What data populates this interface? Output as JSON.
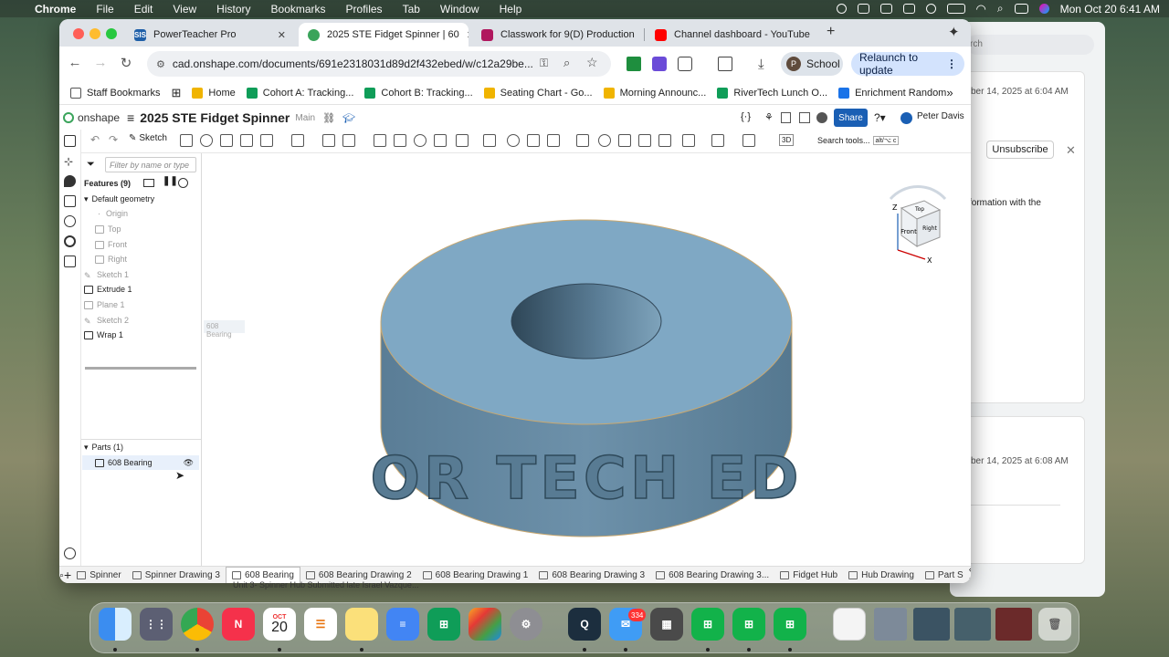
{
  "menubar": {
    "app": "Chrome",
    "items": [
      "File",
      "Edit",
      "View",
      "History",
      "Bookmarks",
      "Profiles",
      "Tab",
      "Window",
      "Help"
    ],
    "clock": "Mon Oct 20  6:41 AM"
  },
  "background_window": {
    "search_placeholder": "rch",
    "text1": "ber 14, 2025 at 6:04 AM",
    "unsubscribe": "Unsubscribe",
    "text2": "formation with the",
    "text3": "ber 14, 2025 at 6:08 AM"
  },
  "tabs": [
    {
      "title": "PowerTeacher Pro",
      "fav_color": "#1f5fa8",
      "fav_text": "SIS"
    },
    {
      "title": "2025 STE Fidget Spinner | 60",
      "fav_color": "#3aa45b",
      "fav_text": ""
    },
    {
      "title": "Classwork for 9(D) Production",
      "fav_color": "#b0185e",
      "fav_text": ""
    },
    {
      "title": "Channel dashboard - YouTube",
      "fav_color": "#ff0000",
      "fav_text": ""
    }
  ],
  "toolbar": {
    "url": "cad.onshape.com/documents/691e2318031d89d2f432ebed/w/c12a29be...",
    "profile_letter": "P",
    "profile_label": "School",
    "relaunch": "Relaunch to update"
  },
  "bookmarks": [
    {
      "label": "Staff Bookmarks",
      "color": "#555"
    },
    {
      "label": "Home",
      "color": "#f0b400"
    },
    {
      "label": "Cohort A: Tracking...",
      "color": "#0f9d58"
    },
    {
      "label": "Cohort B: Tracking...",
      "color": "#0f9d58"
    },
    {
      "label": "Seating Chart - Go...",
      "color": "#f0b400"
    },
    {
      "label": "Morning Announc...",
      "color": "#f0b400"
    },
    {
      "label": "RiverTech Lunch O...",
      "color": "#0f9d58"
    },
    {
      "label": "Enrichment Random",
      "color": "#1a73e8"
    }
  ],
  "onshape": {
    "brand": "onshape",
    "doc_title": "2025 STE Fidget Spinner",
    "branch": "Main",
    "share": "Share",
    "user": "Peter Davis",
    "sketch_label": "Sketch",
    "search_tools": "Search tools...",
    "search_shortcut": "alt/⌥ c",
    "view_mode": "3D",
    "filter_placeholder": "Filter by name or type",
    "features_header": "Features (9)",
    "default_geometry": "Default geometry",
    "features": [
      {
        "label": "Origin",
        "dim": true,
        "indent": 2
      },
      {
        "label": "Top",
        "dim": true,
        "indent": 1
      },
      {
        "label": "Front",
        "dim": true,
        "indent": 1
      },
      {
        "label": "Right",
        "dim": true,
        "indent": 1
      },
      {
        "label": "Sketch 1",
        "dim": true,
        "indent": 0
      },
      {
        "label": "Extrude 1",
        "dim": false,
        "indent": 0
      },
      {
        "label": "Plane 1",
        "dim": true,
        "indent": 0
      },
      {
        "label": "Sketch 2",
        "dim": true,
        "indent": 0
      },
      {
        "label": "Wrap 1",
        "dim": false,
        "indent": 0
      }
    ],
    "parts_header": "Parts (1)",
    "part": "608 Bearing",
    "part_tooltip": "608 Bearing",
    "model_text": "OR TECH ED",
    "cube": {
      "top": "Top",
      "front": "Front",
      "right": "Right",
      "z": "Z",
      "x": "X"
    }
  },
  "bottom_tabs": [
    {
      "label": "Spinner",
      "active": false
    },
    {
      "label": "Spinner Drawing 3",
      "active": false
    },
    {
      "label": "608 Bearing",
      "active": true
    },
    {
      "label": "608 Bearing Drawing 2",
      "active": false
    },
    {
      "label": "608 Bearing Drawing 1",
      "active": false
    },
    {
      "label": "608 Bearing Drawing 3",
      "active": false
    },
    {
      "label": "608 Bearing Drawing 3...",
      "active": false
    },
    {
      "label": "Fidget Hub",
      "active": false
    },
    {
      "label": "Hub Drawing",
      "active": false
    },
    {
      "label": "Part S",
      "active": false
    }
  ],
  "status_line": "Unit 3- Spinner Hub Submitted late Israel Vazque...",
  "dock": {
    "calendar_month": "OCT",
    "calendar_day": "20",
    "mail_badge": "334"
  }
}
